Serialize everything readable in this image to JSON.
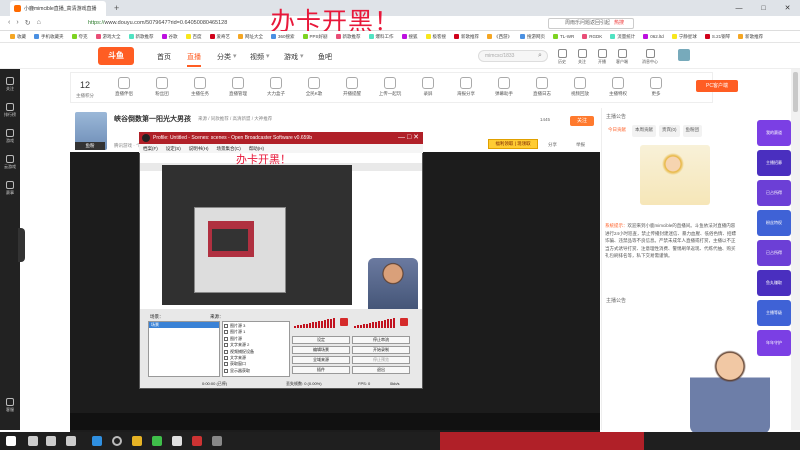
{
  "browser": {
    "tab_title": "小鹿mimcible直播_高清游戏直播",
    "url_scheme": "https://",
    "url_host": "www.douyu.com",
    "url_path": "/5079647?",
    "url_query": "rid=0.64050080465128",
    "address_search": "周雨乐问题返回引起",
    "hot_label": "热搜",
    "window_controls": [
      "—",
      "□",
      "✕"
    ]
  },
  "headline": "办卡开黑！",
  "bookmarks": [
    "收藏",
    "手机收藏夹",
    "夸克",
    "游戏大全",
    "新歌推荐",
    "谷歌",
    "百度",
    "爱奇艺",
    "网址大全",
    "360搜索",
    "PPS好剧",
    "新歌推荐",
    "爆料工作",
    "搜狐",
    "极客搜",
    "新歌推荐",
    "《西游》",
    "搜游网页",
    "TL-WR",
    "RGDK",
    "流量统计",
    "062.ltd",
    "宁静星球",
    "S.21钢琴",
    "新歌推荐"
  ],
  "site": {
    "logo": "斗鱼",
    "nav": [
      "首页",
      "直播",
      "分类",
      "视频",
      "游戏",
      "鱼吧"
    ],
    "nav_dropdown_marks": [
      "▾",
      "▾",
      "▾"
    ],
    "search_placeholder": "mimcsc/1833",
    "search_button_icon": "search-icon",
    "top_icons": [
      "历史",
      "关注",
      "开播",
      "客户端",
      "消息中心"
    ],
    "accent_color": "#ff5d23"
  },
  "leftbar": {
    "items": [
      "关注",
      "排行榜",
      "游戏",
      "云游戏",
      "赛事",
      "客服"
    ]
  },
  "category_bar": {
    "count": "12",
    "count_label": "主播积分",
    "items": [
      "直播伴侣",
      "粉丝团",
      "主播任务",
      "直播管理",
      "大力盒子",
      "全民K歌",
      "开播提醒",
      "上传一起玩",
      "录屏",
      "海报分享",
      "弹幕助手",
      "直播日志",
      "视频回放",
      "主播特权",
      "更多"
    ],
    "pc_button": "PC客户端"
  },
  "room": {
    "title": "峡谷倒数第一阳光大男孩",
    "meta": "来源  / 同款推荐 / 高清新盟 / 大神推荐",
    "sub": "腾讯游戏 · 个人",
    "badge": "鱼粉",
    "hot_count": "1445",
    "follow_label": "关注",
    "level_badge": "Lv",
    "actions": [
      "分享",
      "举报"
    ],
    "ad_label": "福利领取 | 现领取"
  },
  "obs": {
    "title": "Profile: Untitled - Scenes: scenes - Open Broadcaster Software v0.659b",
    "menu": [
      "档案(F)",
      "设定(S)",
      "说明书(H)",
      "场景集合(C)",
      "帮助(H)"
    ],
    "inner_headline": "办卡开黑！",
    "scenes_label": "场景：",
    "sources_label": "来源：",
    "scenes": [
      "场景"
    ],
    "sources": [
      "图片源 3",
      "图片源 1",
      "图片源",
      "文字来源 2",
      "视频捕捉设备",
      "文字来源",
      "获取窗口",
      "显示器获取"
    ],
    "buttons": [
      "设定",
      "编辑场景",
      "全域来源",
      "插件",
      "停止串流",
      "开始录制",
      "停止预览",
      "退出"
    ],
    "status": [
      "0:00:00 (已停)",
      "丢失帧数: 0 (0.00%)",
      "FPS: 0",
      "0kb/s"
    ]
  },
  "chat": {
    "anchor_label": "主播公告",
    "tabs": [
      "今日贡献",
      "本周贡献",
      "贵宾(0)",
      "鱼粉团"
    ],
    "system_label": "系统提示：",
    "system_text": "欢迎来到小鹿mimcible的直播间。斗鱼依法对直播内容进行24小时巡查，禁止传播封建迷信、暴力血腥、低俗色情、招嫖诈骗、违禁品等不良信息。严禁未成年人直播或打赏，主播以不正当方式诱导打赏、注意理性消费、警惕刷单返现、代练代抽、购买礼包刷排名等，私下交易需谨慎。",
    "anchor_label2": "主播公告"
  },
  "promo": {
    "items": [
      "我的赛道",
      "主播招募",
      "已占所得",
      "粉丝特权",
      "已占所得",
      "鱼丸赚取",
      "主播等级",
      "年年守护"
    ]
  },
  "watermark": "斗鱼",
  "taskbar": {
    "icons": [
      "start-icon",
      "search-icon",
      "cortana-icon",
      "task-view-icon",
      "edge-icon",
      "obs-icon",
      "folder-icon",
      "wechat-icon",
      "chrome-icon",
      "game-icon",
      "file-icon"
    ]
  }
}
